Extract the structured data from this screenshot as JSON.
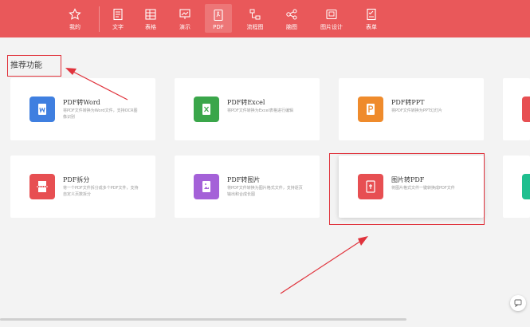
{
  "nav": {
    "items": [
      {
        "label": "我的",
        "icon": "star-icon"
      },
      {
        "label": "文字",
        "icon": "document-icon"
      },
      {
        "label": "表格",
        "icon": "table-icon"
      },
      {
        "label": "演示",
        "icon": "presentation-icon"
      },
      {
        "label": "PDF",
        "icon": "pdf-icon"
      },
      {
        "label": "流程图",
        "icon": "flowchart-icon"
      },
      {
        "label": "脑图",
        "icon": "mindmap-icon"
      },
      {
        "label": "图片设计",
        "icon": "image-design-icon"
      },
      {
        "label": "表单",
        "icon": "form-icon"
      }
    ],
    "active": "PDF"
  },
  "section": {
    "title": "推荐功能"
  },
  "cards": [
    {
      "title": "PDF转Word",
      "desc": "将PDF文件转换为Word文件，支持OCR图像识别",
      "color": "#3f7fe0",
      "icon": "word-icon"
    },
    {
      "title": "PDF转Excel",
      "desc": "将PDF文件转换为Excel表格进行编辑",
      "color": "#3aa64a",
      "icon": "excel-icon"
    },
    {
      "title": "PDF转PPT",
      "desc": "将PDF文件转换为PPT幻灯片",
      "color": "#ef8b2c",
      "icon": "ppt-icon"
    },
    {
      "title": "PDF拆分",
      "desc": "将一个PDF文件拆分成多个PDF文件，支持自定义页数拆分",
      "color": "#e74f52",
      "icon": "split-icon"
    },
    {
      "title": "PDF转图片",
      "desc": "将PDF文件转换为图片格式文件，支持逐页输出和合成长图",
      "color": "#a461d8",
      "icon": "pdf-to-image-icon"
    },
    {
      "title": "图片转PDF",
      "desc": "将图片格式文件一键转换成PDF文件",
      "color": "#e74f52",
      "icon": "image-to-pdf-icon"
    }
  ],
  "partials": [
    {
      "color": "#e74f52"
    },
    {
      "color": "#1fbf8f"
    }
  ],
  "colors": {
    "topbar": "#e9585a",
    "annotation": "#e0333c"
  }
}
